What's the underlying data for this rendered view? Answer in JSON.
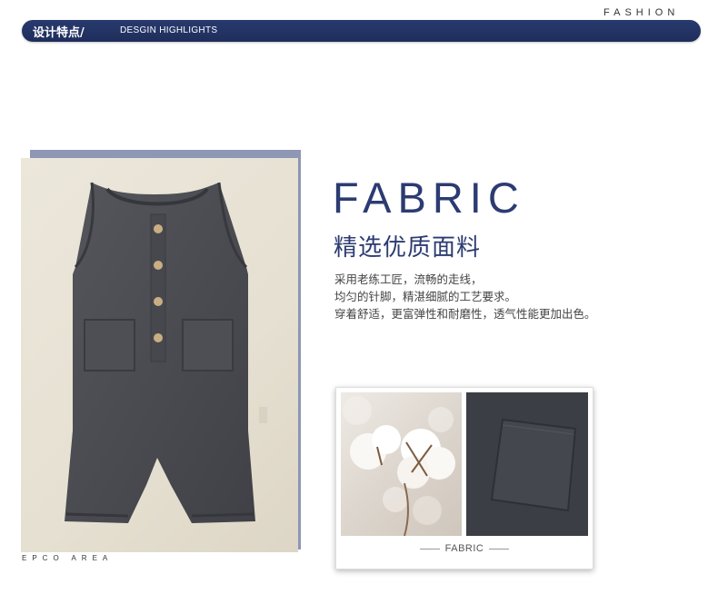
{
  "top_tag": "FASHION",
  "header": {
    "title_cn": "设计特点/",
    "title_en": "DESGIN HIGHLIGHTS"
  },
  "photo_caption": "EPCO AREA",
  "main": {
    "title_en": "FABRIC",
    "title_cn": "精选优质面料",
    "description": [
      "采用老练工匠，流畅的走线，",
      "均匀的针脚，精湛细腻的工艺要求。",
      "穿着舒适，更富弹性和耐磨性，透气性能更加出色。"
    ]
  },
  "card": {
    "label": "FABRIC"
  },
  "colors": {
    "navy": "#2c3b71",
    "header_bar": "#243566",
    "photo_frame": "#8e97b3",
    "garment": "#4a4b50"
  },
  "icons": [
    "romper-photo",
    "cotton-photo",
    "fabric-pocket-photo"
  ]
}
